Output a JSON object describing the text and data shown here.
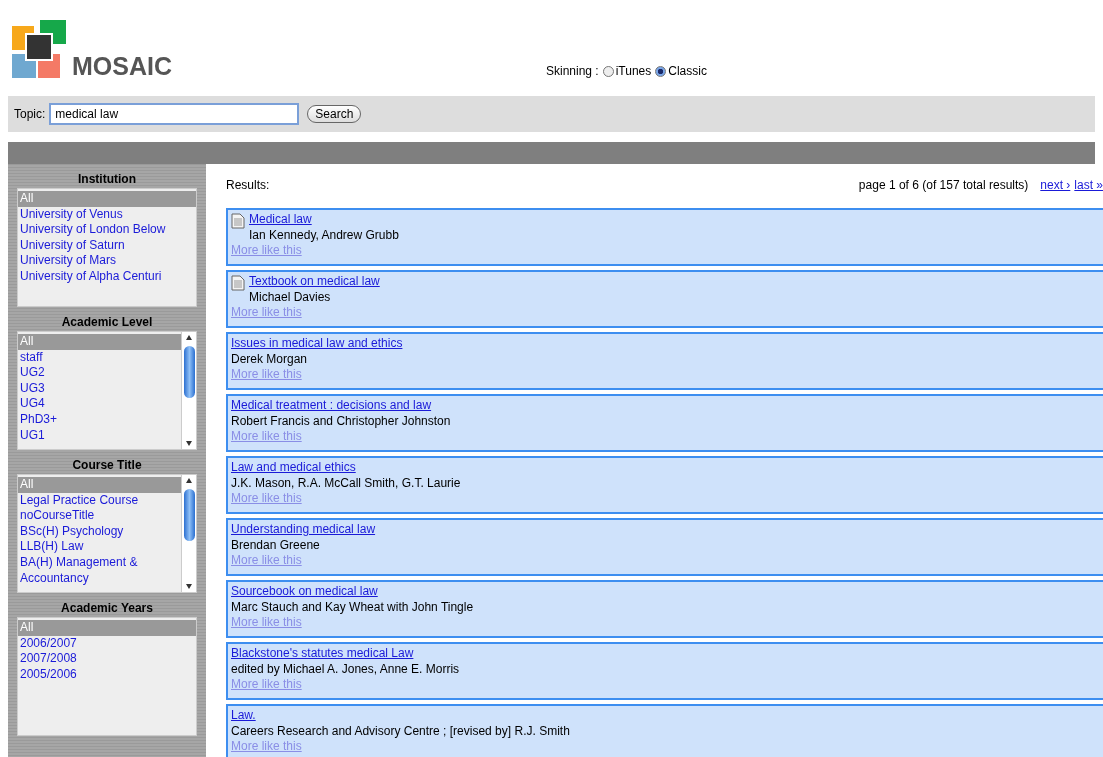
{
  "logo": {
    "text": "MOSAIC"
  },
  "skinning": {
    "label": "Skinning :",
    "options": [
      {
        "label": "iTunes",
        "selected": false
      },
      {
        "label": "Classic",
        "selected": true
      }
    ]
  },
  "search": {
    "label": "Topic:",
    "value": "medical law",
    "button": "Search"
  },
  "filters": [
    {
      "title": "Institution",
      "scroll": false,
      "items": [
        {
          "label": "All",
          "selected": true
        },
        {
          "label": "University of Venus",
          "selected": false
        },
        {
          "label": "University of London Below",
          "selected": false
        },
        {
          "label": "University of Saturn",
          "selected": false
        },
        {
          "label": "University of Mars",
          "selected": false
        },
        {
          "label": "University of Alpha Centuri",
          "selected": false
        }
      ]
    },
    {
      "title": "Academic Level",
      "scroll": true,
      "items": [
        {
          "label": "All",
          "selected": true
        },
        {
          "label": "staff",
          "selected": false
        },
        {
          "label": "UG2",
          "selected": false
        },
        {
          "label": "UG3",
          "selected": false
        },
        {
          "label": "UG4",
          "selected": false
        },
        {
          "label": "PhD3+",
          "selected": false
        },
        {
          "label": "UG1",
          "selected": false
        }
      ]
    },
    {
      "title": "Course Title",
      "scroll": true,
      "items": [
        {
          "label": "All",
          "selected": true
        },
        {
          "label": "Legal Practice Course",
          "selected": false
        },
        {
          "label": "noCourseTitle",
          "selected": false
        },
        {
          "label": "BSc(H) Psychology",
          "selected": false
        },
        {
          "label": "LLB(H) Law",
          "selected": false
        },
        {
          "label": "BA(H) Management & Accountancy",
          "selected": false
        }
      ]
    },
    {
      "title": "Academic Years",
      "scroll": false,
      "items": [
        {
          "label": "All",
          "selected": true
        },
        {
          "label": "2006/2007",
          "selected": false
        },
        {
          "label": "2007/2008",
          "selected": false
        },
        {
          "label": "2005/2006",
          "selected": false
        }
      ]
    }
  ],
  "results": {
    "label": "Results:",
    "page_info": "page 1 of 6 (of 157 total results)",
    "next": "next ›",
    "last": "last »",
    "items": [
      {
        "title": "Medical law",
        "authors": "Ian Kennedy, Andrew Grubb",
        "more": "More like this",
        "icon": true
      },
      {
        "title": "Textbook on medical law",
        "authors": "Michael Davies",
        "more": "More like this",
        "icon": true
      },
      {
        "title": "Issues in medical law and ethics",
        "authors": "Derek Morgan",
        "more": "More like this",
        "icon": false
      },
      {
        "title": "Medical treatment : decisions and law",
        "authors": "Robert Francis and Christopher Johnston",
        "more": "More like this",
        "icon": false
      },
      {
        "title": "Law and medical ethics",
        "authors": "J.K. Mason, R.A. McCall Smith, G.T. Laurie",
        "more": "More like this",
        "icon": false
      },
      {
        "title": "Understanding medical law",
        "authors": "Brendan Greene",
        "more": "More like this",
        "icon": false
      },
      {
        "title": "Sourcebook on medical law",
        "authors": "Marc Stauch and Kay Wheat with John Tingle",
        "more": "More like this",
        "icon": false
      },
      {
        "title": "Blackstone's statutes medical Law",
        "authors": "edited by Michael A. Jones, Anne E. Morris",
        "more": "More like this",
        "icon": false
      },
      {
        "title": "Law.",
        "authors": "Careers Research and Advisory Centre ; [revised by] R.J. Smith",
        "more": "More like this",
        "icon": false
      }
    ]
  }
}
